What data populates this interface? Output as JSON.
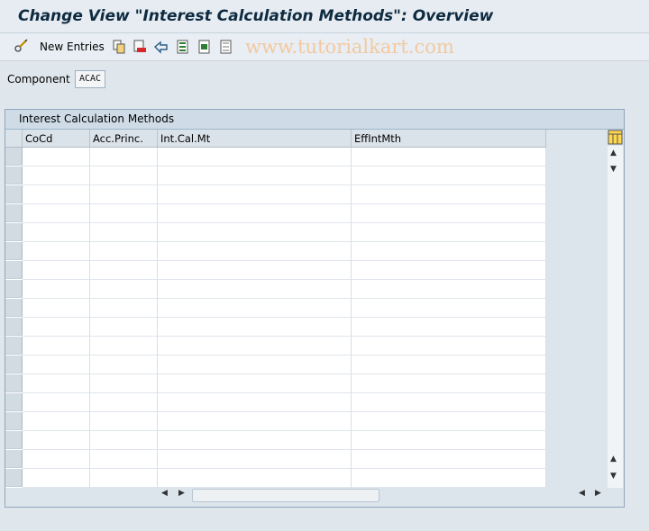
{
  "title": "Change View \"Interest Calculation Methods\": Overview",
  "toolbar": {
    "new_entries_label": "New Entries",
    "icons": [
      "glasses-pencil-icon",
      "copy-icon",
      "delete-icon",
      "undo-icon",
      "select-all-icon",
      "select-block-icon",
      "deselect-all-icon"
    ]
  },
  "watermark": "www.tutorialkart.com",
  "component": {
    "label": "Component",
    "value": "ACAC"
  },
  "table": {
    "title": "Interest Calculation Methods",
    "columns": [
      "CoCd",
      "Acc.Princ.",
      "Int.Cal.Mt",
      "EffIntMth"
    ],
    "row_count": 18
  },
  "colors": {
    "title": "#0e2a40",
    "watermark": "#f2c9a0",
    "header_bg": "#dbe3ea"
  }
}
